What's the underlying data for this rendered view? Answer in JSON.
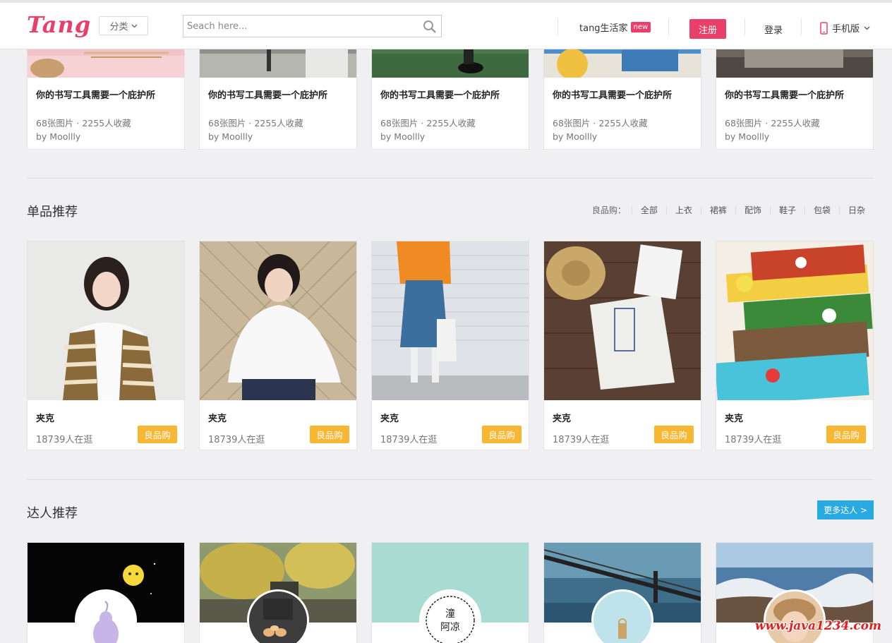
{
  "header": {
    "logo": "Tang",
    "category_label": "分类",
    "search_placeholder": "Seach here...",
    "tang_life_label": "tang生活家",
    "new_badge": "new",
    "register_label": "注册",
    "login_label": "登录",
    "mobile_label": "手机版"
  },
  "albums": [
    {
      "title": "你的书写工具需要一个庇护所",
      "stats": "68张图片 · 2255人收藏",
      "author": "by Moollly"
    },
    {
      "title": "你的书写工具需要一个庇护所",
      "stats": "68张图片 · 2255人收藏",
      "author": "by Moollly"
    },
    {
      "title": "你的书写工具需要一个庇护所",
      "stats": "68张图片 · 2255人收藏",
      "author": "by Moollly"
    },
    {
      "title": "你的书写工具需要一个庇护所",
      "stats": "68张图片 · 2255人收藏",
      "author": "by Moollly"
    },
    {
      "title": "你的书写工具需要一个庇护所",
      "stats": "68张图片 · 2255人收藏",
      "author": "by Moollly"
    }
  ],
  "products_section": {
    "title": "单品推荐",
    "filter_label": "良品购：",
    "filters": [
      "全部",
      "上衣",
      "裙裤",
      "配饰",
      "鞋子",
      "包袋",
      "日杂"
    ],
    "items": [
      {
        "title": "夹克",
        "meta": "18739人在逛",
        "button": "良品购"
      },
      {
        "title": "夹克",
        "meta": "18739人在逛",
        "button": "良品购"
      },
      {
        "title": "夹克",
        "meta": "18739人在逛",
        "button": "良品购"
      },
      {
        "title": "夹克",
        "meta": "18739人在逛",
        "button": "良品购"
      },
      {
        "title": "夹克",
        "meta": "18739人在逛",
        "button": "良品购"
      }
    ]
  },
  "experts_section": {
    "title": "达人推荐",
    "more_label": "更多达人 >"
  },
  "watermark": "www.java1234.com",
  "colors": {
    "brand": "#e8406a",
    "buy": "#f7b733",
    "more": "#29a9e1"
  }
}
